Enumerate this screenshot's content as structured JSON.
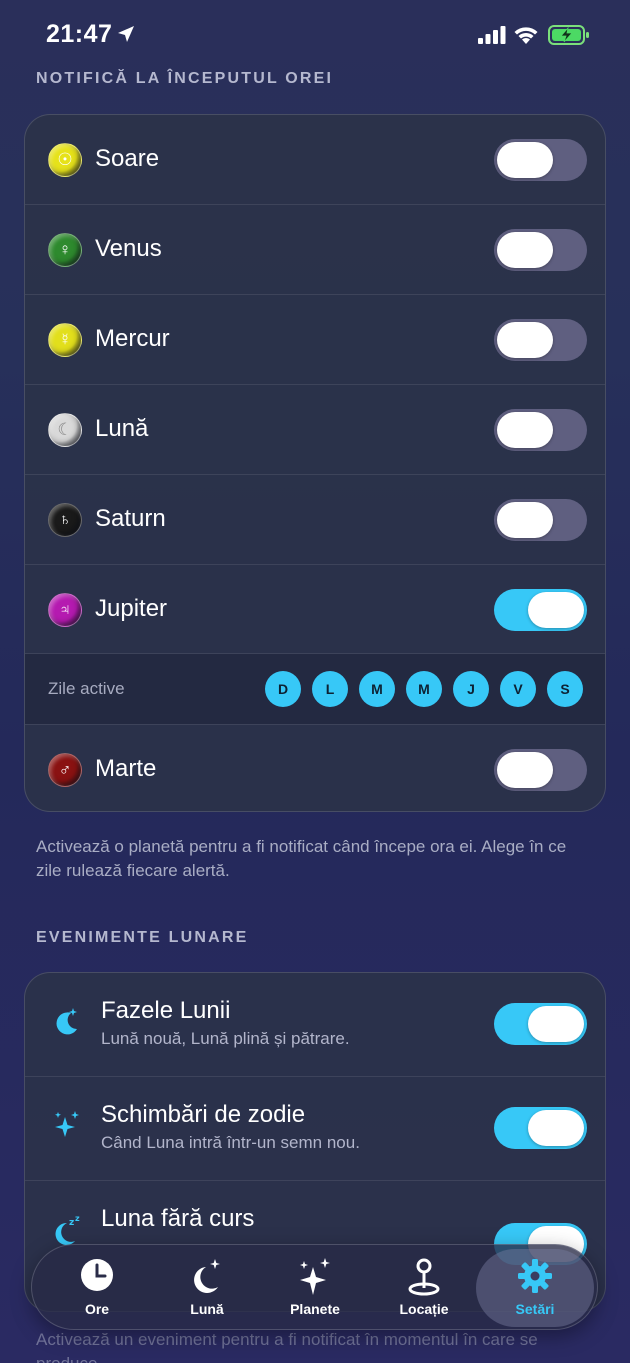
{
  "status": {
    "time": "21:47"
  },
  "section_hour": {
    "title": "NOTIFICĂ LA ÎNCEPUTUL OREI"
  },
  "planets": [
    {
      "label": "Soare",
      "on": false,
      "icon": "sun-icon",
      "symbol": "☉",
      "color": "#e6e21a"
    },
    {
      "label": "Venus",
      "on": false,
      "icon": "venus-icon",
      "symbol": "♀",
      "color": "#2e8a2e"
    },
    {
      "label": "Mercur",
      "on": false,
      "icon": "mercury-icon",
      "symbol": "☿",
      "color": "#e2df1c"
    },
    {
      "label": "Lună",
      "on": false,
      "icon": "moon-icon",
      "symbol": "☾",
      "color": "#d9d9d9"
    },
    {
      "label": "Saturn",
      "on": false,
      "icon": "saturn-icon",
      "symbol": "♄",
      "color": "#1a1a1a"
    },
    {
      "label": "Jupiter",
      "on": true,
      "icon": "jupiter-icon",
      "symbol": "♃",
      "color": "#b51ab0"
    },
    {
      "label": "Marte",
      "on": false,
      "icon": "mars-icon",
      "symbol": "♂",
      "color": "#8a1212"
    }
  ],
  "active_days": {
    "label": "Zile active",
    "days": [
      "D",
      "L",
      "M",
      "M",
      "J",
      "V",
      "S"
    ]
  },
  "hour_footnote": "Activează o planetă pentru a fi notificat când începe ora ei. Alege în ce zile rulează fiecare alertă.",
  "section_lunar": {
    "title": "EVENIMENTE LUNARE"
  },
  "lunar_events": [
    {
      "title": "Fazele Lunii",
      "subtitle": "Lună nouă, Lună plină și pătrare.",
      "on": true,
      "icon": "moon-stars-icon"
    },
    {
      "title": "Schimbări de zodie",
      "subtitle": "Când Luna intră într-un semn nou.",
      "on": true,
      "icon": "sparkles-icon"
    },
    {
      "title": "Luna fără curs",
      "subtitle": "",
      "on": true,
      "icon": "moon-zzz-icon"
    }
  ],
  "lunar_footnote": "Activează un eveniment pentru a fi notificat în momentul în care se produce.",
  "tabs": [
    {
      "label": "Ore",
      "icon": "clock-icon",
      "active": false
    },
    {
      "label": "Lună",
      "icon": "moon-tab-icon",
      "active": false
    },
    {
      "label": "Planete",
      "icon": "sparkle-tab-icon",
      "active": false
    },
    {
      "label": "Locație",
      "icon": "location-pin-icon",
      "active": false
    },
    {
      "label": "Setări",
      "icon": "gear-icon",
      "active": true
    }
  ],
  "colors": {
    "accent": "#37c8f7",
    "toggle_off": "#5f5f80"
  }
}
